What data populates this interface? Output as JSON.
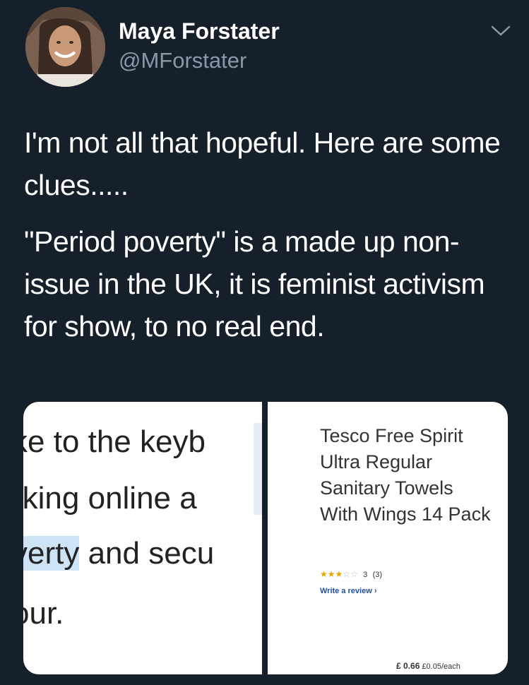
{
  "tweet": {
    "author_name": "Maya Forstater",
    "author_handle": "@MForstater",
    "paragraphs": [
      "I'm not all that hopeful. Here are some clues.....",
      "\"Period poverty\" is a made up non-issue in the UK, it is  feminist activism for show, to no real end."
    ]
  },
  "media": {
    "left_image": {
      "lines": [
        "ke to the keyb",
        "rking online a",
        "verty",
        " and secu",
        "our."
      ]
    },
    "right_image": {
      "product_title": "Tesco Free Spirit Ultra Regular Sanitary Towels With Wings 14 Pack",
      "rating_value": 3,
      "rating_max": 5,
      "rating_text": "3",
      "rating_count": "(3)",
      "write_review": "Write a review",
      "price": "£ 0.66",
      "unit_price": "£0.05/each"
    }
  },
  "colors": {
    "background": "#15202b",
    "text": "#ffffff",
    "secondary_text": "#8899a6"
  }
}
